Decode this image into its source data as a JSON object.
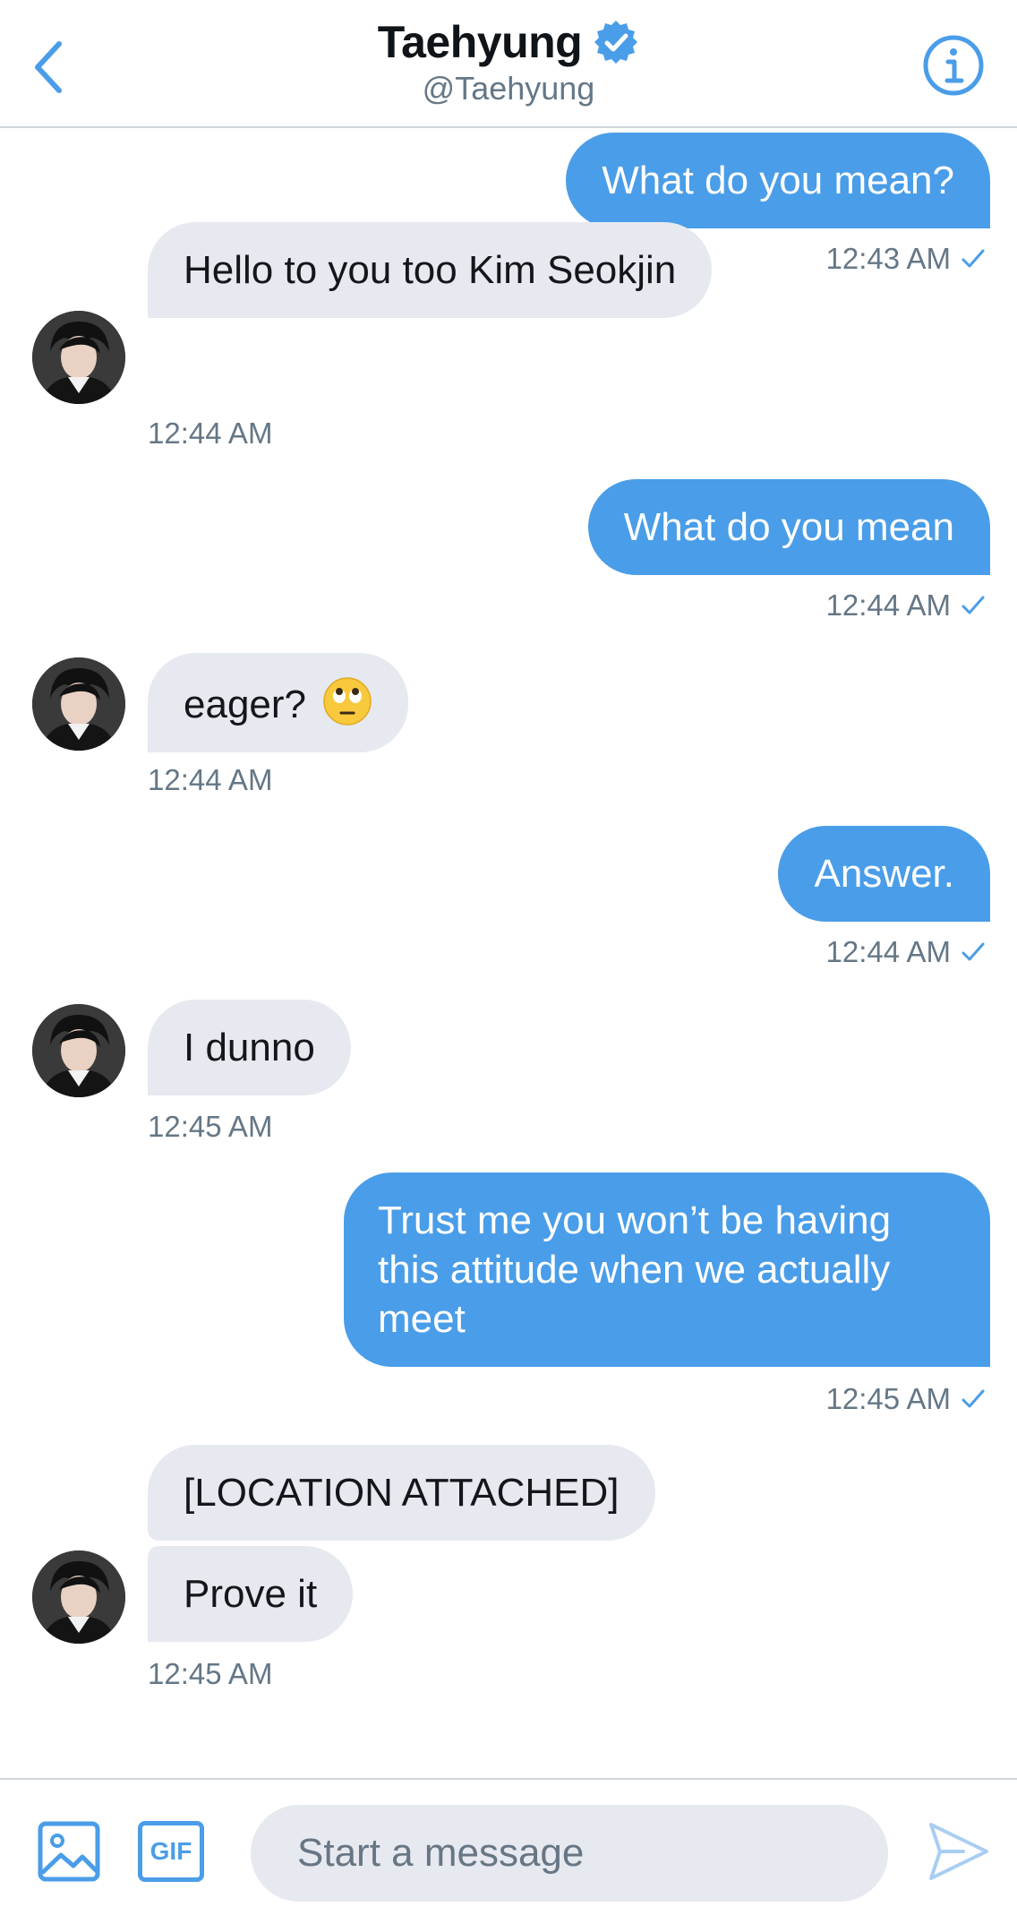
{
  "header": {
    "title": "Taehyung",
    "handle": "@Taehyung"
  },
  "colors": {
    "accent": "#4a9de8",
    "incoming_bubble": "#e6e9ef",
    "timestamp": "#657786"
  },
  "messages": [
    {
      "direction": "out",
      "text": "What do you mean?",
      "time": "12:43 AM",
      "read": true
    },
    {
      "direction": "in",
      "text": "Hello to you too Kim Seokjin",
      "time": "12:44 AM"
    },
    {
      "direction": "out",
      "text": "What do you mean",
      "time": "12:44 AM",
      "read": true
    },
    {
      "direction": "in",
      "text": "eager?",
      "emoji": "face-with-rolling-eyes-icon",
      "time": "12:44 AM"
    },
    {
      "direction": "out",
      "text": "Answer.",
      "time": "12:44 AM",
      "read": true
    },
    {
      "direction": "in",
      "text": "I dunno",
      "time": "12:45 AM"
    },
    {
      "direction": "out",
      "text": "Trust me you won’t be having this attitude when we actually meet",
      "time": "12:45 AM",
      "read": true
    },
    {
      "direction": "in",
      "text": "[LOCATION ATTACHED]"
    },
    {
      "direction": "in",
      "text": "Prove it",
      "time": "12:45 AM"
    }
  ],
  "composer": {
    "gif_label": "GIF",
    "placeholder": "Start a message"
  }
}
